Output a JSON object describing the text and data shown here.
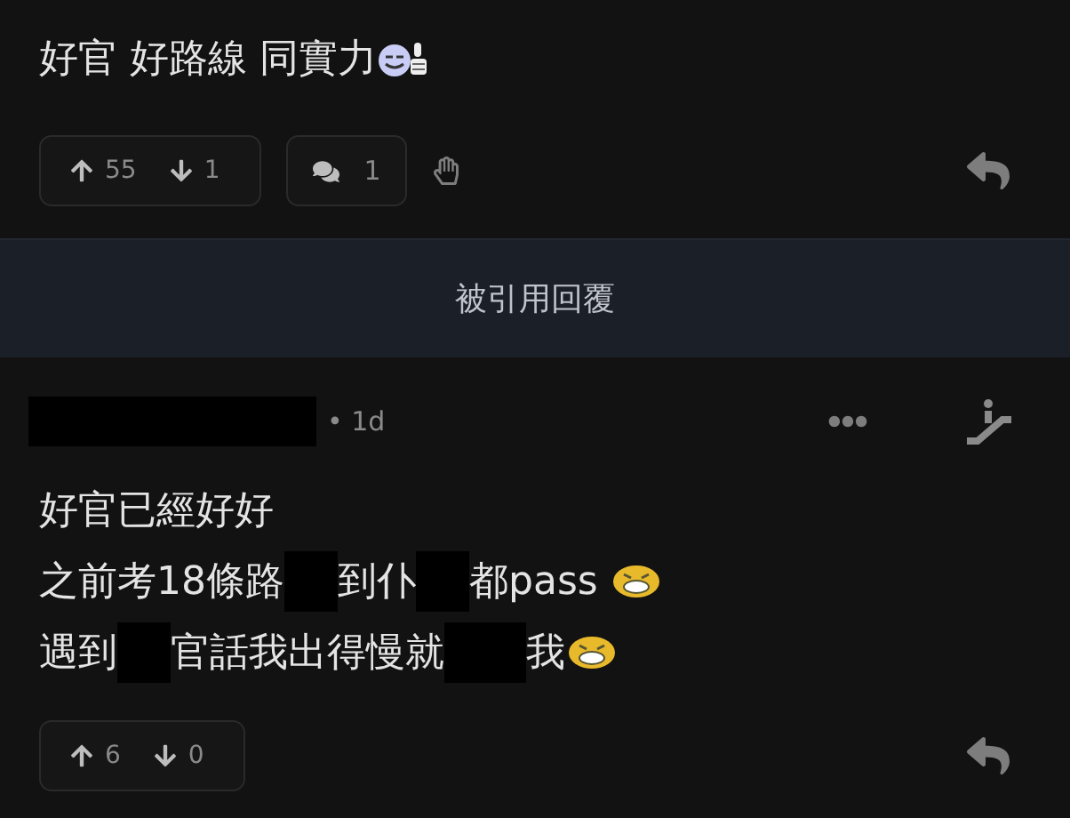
{
  "post": {
    "lines": [
      [
        {
          "kind": "text",
          "text": "好官 好路線 同實力"
        },
        {
          "kind": "thumbsmiley"
        }
      ]
    ],
    "actions": {
      "upvotes": "55",
      "downvotes": "1",
      "replies": "1",
      "show_wave": true
    }
  },
  "quoted_bar": {
    "label": "被引用回覆"
  },
  "reply": {
    "author_redacted": true,
    "time": "• 1d",
    "lines": [
      [
        {
          "kind": "text",
          "text": "好官已經好好"
        }
      ],
      [
        {
          "kind": "text",
          "text": "之前考18條路"
        },
        {
          "kind": "redacted"
        },
        {
          "kind": "text",
          "text": "到仆"
        },
        {
          "kind": "redacted"
        },
        {
          "kind": "text",
          "text": "都pass "
        },
        {
          "kind": "laughface"
        }
      ],
      [
        {
          "kind": "text",
          "text": "遇到"
        },
        {
          "kind": "redacted"
        },
        {
          "kind": "text",
          "text": "官話我出得慢就"
        },
        {
          "kind": "redactedwide"
        },
        {
          "kind": "text",
          "text": "我"
        },
        {
          "kind": "laughface"
        }
      ]
    ],
    "actions": {
      "upvotes": "6",
      "downvotes": "0"
    }
  }
}
